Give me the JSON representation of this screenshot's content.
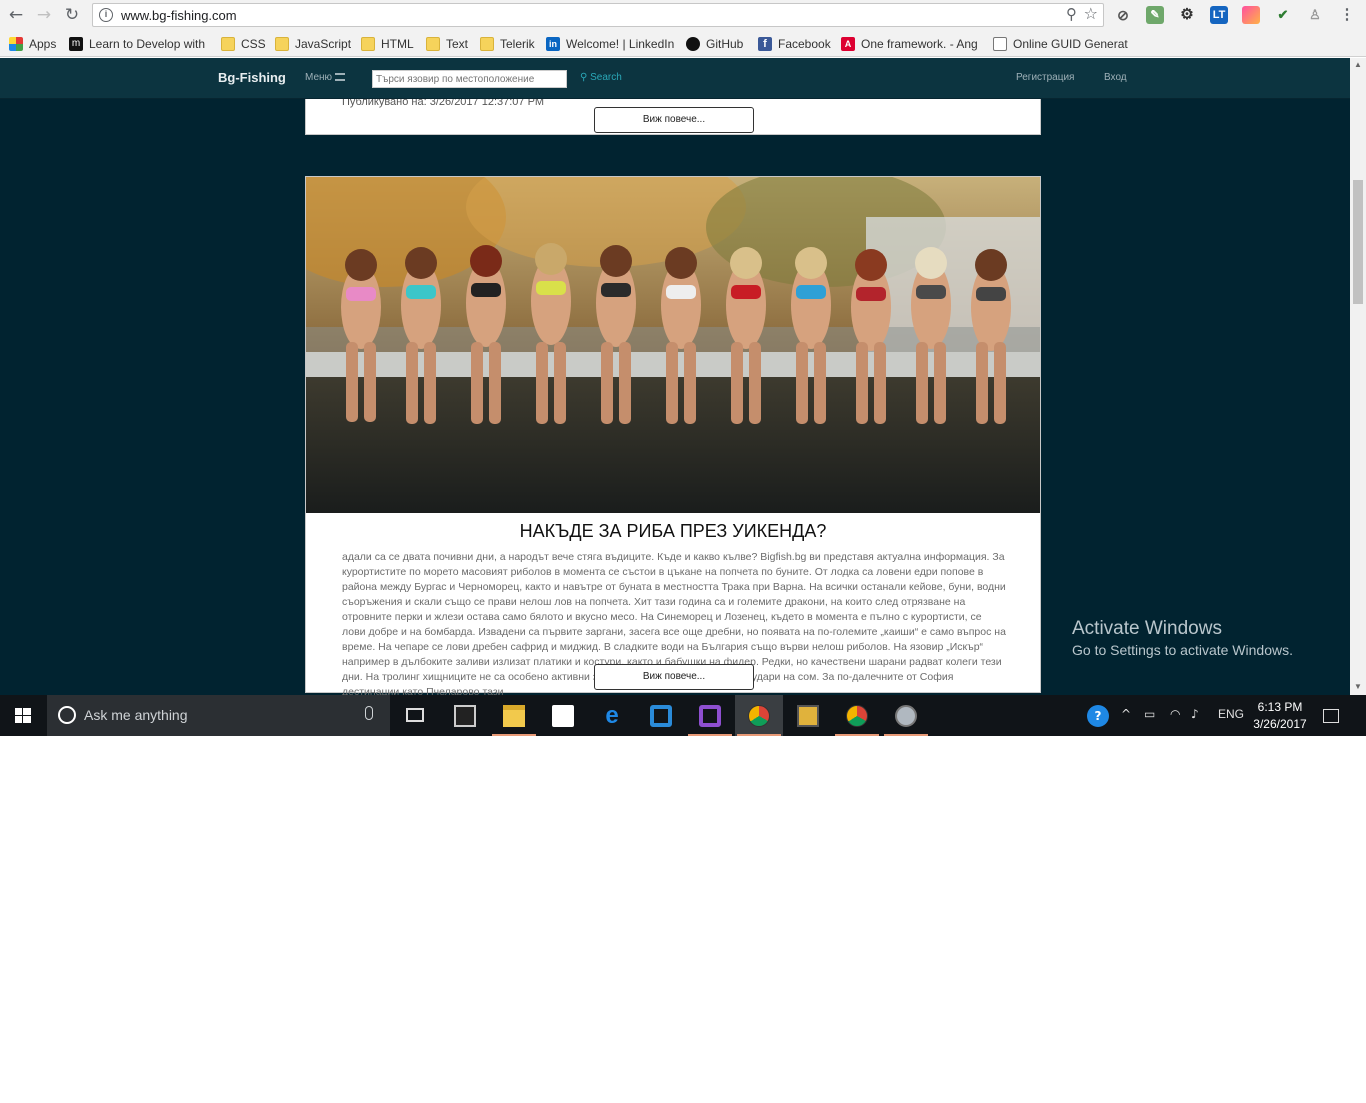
{
  "browser": {
    "url": "www.bg-fishing.com",
    "bookmarks": [
      {
        "label": "Apps",
        "icon": "apps-grid-icon"
      },
      {
        "label": "Learn to Develop with",
        "icon": "m-logo-icon"
      },
      {
        "label": "CSS",
        "icon": "folder-icon"
      },
      {
        "label": "JavaScript",
        "icon": "folder-icon"
      },
      {
        "label": "HTML",
        "icon": "folder-icon"
      },
      {
        "label": "Text",
        "icon": "folder-icon"
      },
      {
        "label": "Telerik",
        "icon": "folder-icon"
      },
      {
        "label": "Welcome! | LinkedIn",
        "icon": "linkedin-icon"
      },
      {
        "label": "GitHub",
        "icon": "github-icon"
      },
      {
        "label": "Facebook",
        "icon": "facebook-icon"
      },
      {
        "label": "One framework. - Ang",
        "icon": "angular-icon"
      },
      {
        "label": "Online GUID Generato",
        "icon": "page-icon"
      }
    ]
  },
  "site": {
    "brand": "Bg-Fishing",
    "menu_label": "Меню",
    "search_placeholder": "Търси язовир по местоположение",
    "search_button": "Search",
    "register": "Регистрация",
    "login": "Вход"
  },
  "posts": [
    {
      "published": "Публикувано на: 3/26/2017 12:37:07 PM",
      "more_label": "Виж повече..."
    },
    {
      "title": "НАКЪДЕ ЗА РИБА ПРЕЗ УИКЕНДА?",
      "excerpt": "адали са се двата почивни дни, а народът вече стяга въдиците. Къде и какво кълве? Bigfish.bg ви представя актуална информация. За курортистите по морето масовият риболов в момента се състои в цъкане на попчета по буните. От лодка са ловени едри попове в района между Бургас и Черноморец, както и навътре от буната в местността Трака при Варна. На всички останали кейове, буни, водни съоръжения и скали също се прави нелош лов на попчета. Хит тази година са и големите дракони, на които след отрязване на отровните перки и жлези остава само бялото и вкусно месо. На Синеморец и Лозенец, където в момента е пълно с курортисти, се лови добре и на бомбарда. Извадени са първите заргани, засега все още дребни, но появата на по-големите „каиши“ е само въпрос на време. На чепаре се лови дребен сафрид и миджид. В сладките води на България също върви нелош риболов. На язовир „Искър“ например в дълбоките заливи излизат платики и костури, както и бабушки на фидер. Редки, но качествени шарани радват колеги тези дни. На тролинг хищниците не са особено активни заради жегите, но има отчетени удари на сом. За по-далечните от София дестинации като Пчеларово тази",
      "more_label": "Виж повече..."
    }
  ],
  "watermark": {
    "title": "Activate Windows",
    "subtitle": "Go to Settings to activate Windows."
  },
  "taskbar": {
    "search_text": "Ask me anything",
    "language": "ENG",
    "time": "6:13 PM",
    "date": "3/26/2017"
  }
}
